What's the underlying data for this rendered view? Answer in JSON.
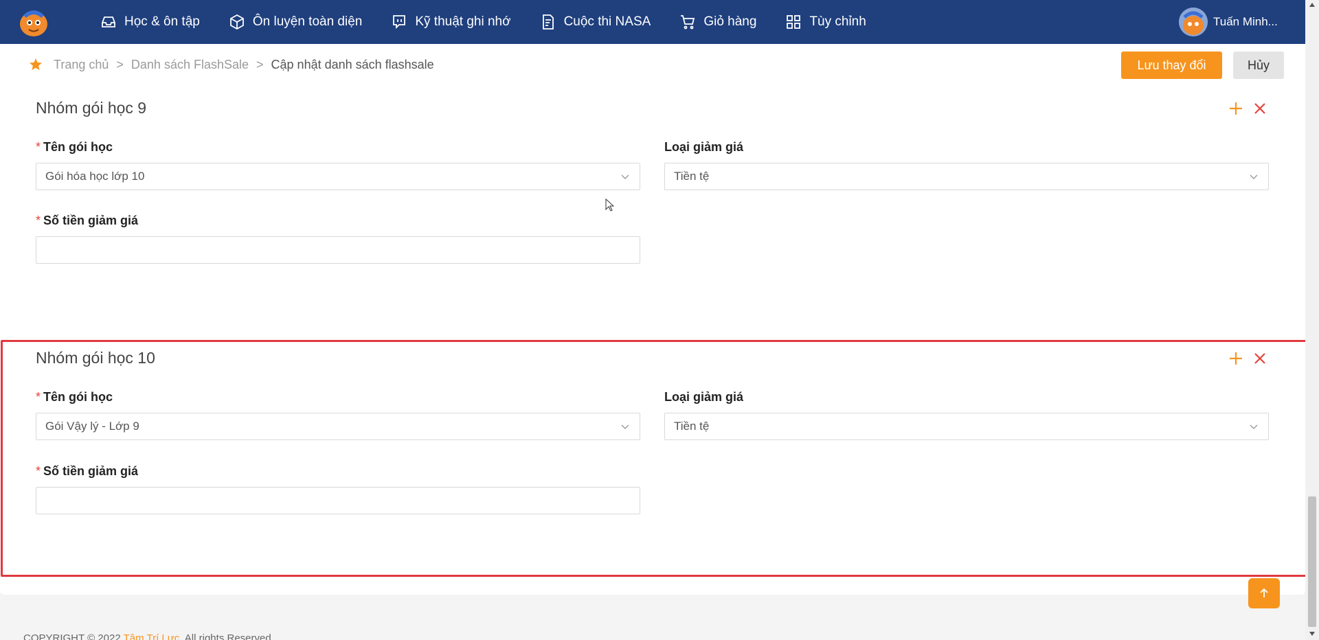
{
  "nav": {
    "items": [
      {
        "label": "Học & ôn tập",
        "icon": "inbox-icon"
      },
      {
        "label": "Ôn luyện toàn diện",
        "icon": "cube-icon"
      },
      {
        "label": "Kỹ thuật ghi nhớ",
        "icon": "message-icon"
      },
      {
        "label": "Cuộc thi NASA",
        "icon": "document-icon"
      },
      {
        "label": "Giỏ hàng",
        "icon": "cart-icon"
      },
      {
        "label": "Tùy chỉnh",
        "icon": "grid-icon"
      }
    ],
    "user_name": "Tuấn Minh..."
  },
  "breadcrumb": {
    "home": "Trang chủ",
    "list": "Danh sách FlashSale",
    "current": "Cập nhật danh sách flashsale",
    "separator": ">"
  },
  "actions": {
    "save_label": "Lưu thay đổi",
    "cancel_label": "Hủy"
  },
  "groups": [
    {
      "title": "Nhóm gói học 9",
      "package_label": "Tên gói học",
      "package_value": "Gói hóa học lớp 10",
      "discount_type_label": "Loại giảm giá",
      "discount_type_value": "Tiền tệ",
      "amount_label": "Số tiền giảm giá",
      "amount_value": ""
    },
    {
      "title": "Nhóm gói học 10",
      "package_label": "Tên gói học",
      "package_value": "Gói Vậy lý - Lớp 9",
      "discount_type_label": "Loại giảm giá",
      "discount_type_value": "Tiền tệ",
      "amount_label": "Số tiền giảm giá",
      "amount_value": ""
    }
  ],
  "required_mark": "*",
  "footer": {
    "prefix": "COPYRIGHT © 2022",
    "brand": "Tâm Trí Lực",
    "suffix": ", All rights Reserved"
  },
  "colors": {
    "nav_bg": "#1f3f7d",
    "accent": "#f7941d",
    "danger": "#e8423a",
    "highlight": "#e0393e"
  }
}
